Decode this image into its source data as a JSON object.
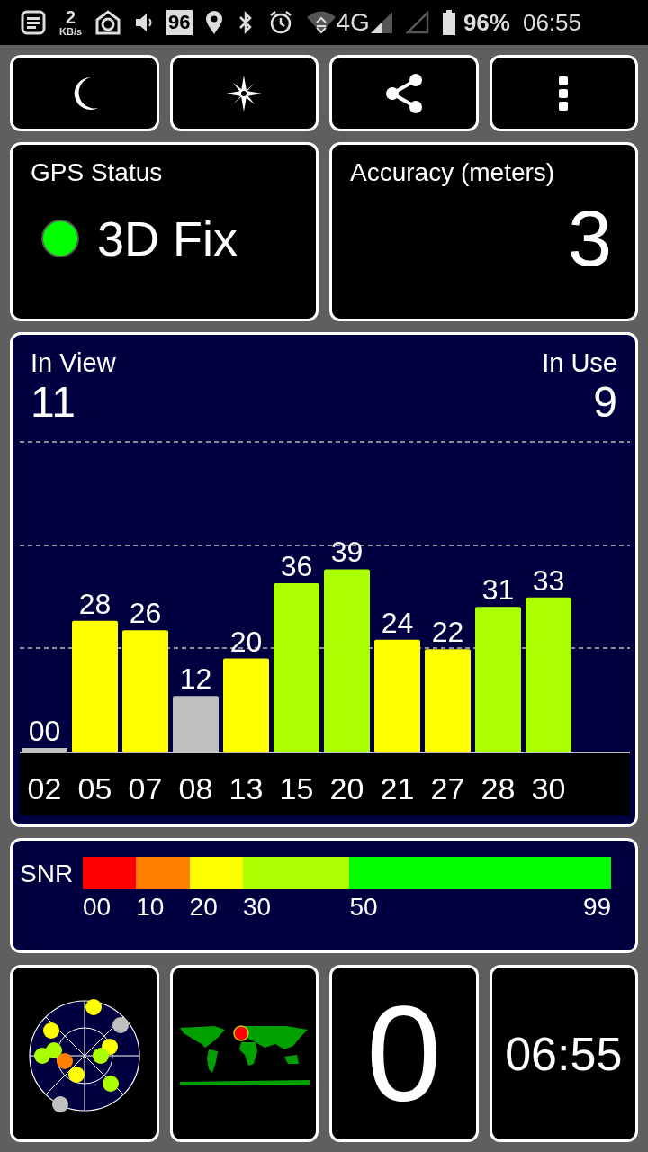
{
  "status_bar": {
    "speed_value": "2",
    "speed_unit": "KB/s",
    "badge": "96",
    "network": "4G",
    "battery": "96%",
    "time": "06:55"
  },
  "toolbar": [
    {
      "kind": "moon"
    },
    {
      "kind": "compass"
    },
    {
      "kind": "share"
    },
    {
      "kind": "more"
    }
  ],
  "gps_status": {
    "title": "GPS Status",
    "fix": "3D Fix"
  },
  "accuracy": {
    "title": "Accuracy (meters)",
    "value": "3"
  },
  "satellites": {
    "in_view_label": "In View",
    "in_view": "11",
    "in_use_label": "In Use",
    "in_use": "9",
    "used": [
      false,
      true,
      true,
      false,
      true,
      true,
      true,
      true,
      true,
      true,
      true
    ],
    "chart_data": {
      "type": "bar",
      "categories": [
        "02",
        "05",
        "07",
        "08",
        "13",
        "15",
        "20",
        "21",
        "27",
        "28",
        "30"
      ],
      "values": [
        0,
        28,
        26,
        12,
        20,
        36,
        39,
        24,
        22,
        31,
        33
      ],
      "data_labels": true,
      "value_labels": [
        "00",
        "28",
        "26",
        "12",
        "20",
        "36",
        "39",
        "24",
        "22",
        "31",
        "33"
      ]
    }
  },
  "snr_legend": {
    "label": "SNR",
    "segments": [
      {
        "label": "00",
        "color": "#ff0000"
      },
      {
        "label": "10",
        "color": "#ff8000"
      },
      {
        "label": "20",
        "color": "#ffff00"
      },
      {
        "label": "30",
        "color": "#aaff00"
      },
      {
        "label": "50",
        "color": "#00ff00"
      }
    ],
    "max_label": "99"
  },
  "tiles": {
    "satellite_count": "0",
    "clock": "06:55"
  }
}
